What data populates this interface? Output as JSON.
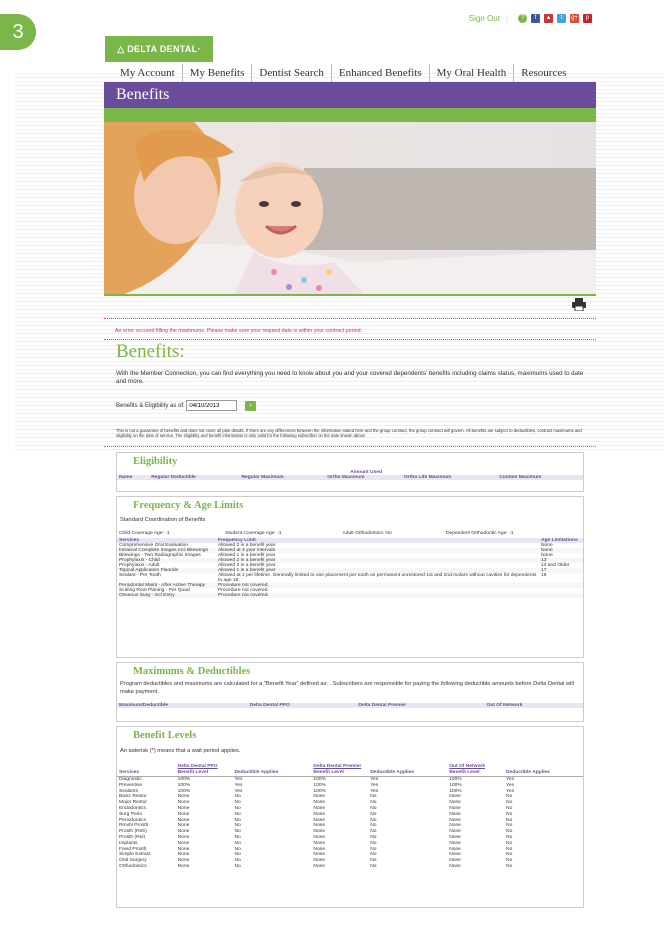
{
  "step": "3",
  "top": {
    "signout": "Sign Out",
    "help": "?",
    "social": [
      "f",
      "▲",
      "t",
      "g+",
      "p"
    ]
  },
  "logo": "△ DELTA DENTAL·",
  "nav": [
    "My Account",
    "My Benefits",
    "Dentist Search",
    "Enhanced Benefits",
    "My Oral Health",
    "Resources"
  ],
  "title_bar": "Benefits",
  "print_icon": "printer",
  "error": "An error occured filling the maximums. Please make sure your request date is within your contract period.",
  "heading": "Benefits:",
  "intro": "With the Member Connection, you can find everything you need to know about you and your covered dependents' benefits including claims status, maximums used to date and more.",
  "asof": {
    "label": "Benefits & Eligibility as of:",
    "value": "04/10/2013",
    "go": "›"
  },
  "disclaimer": "This is not a guarantee of benefits and does not cover all plan details. If there are any differences between the information stated here and the group contract, the group contract will govern. All benefits are subject to deductibles, contract maximums and eligibility on the date of service. The eligibility and benefit information is only valid for the following subscriber on the date shown above.",
  "eligibility": {
    "title": "Eligibility",
    "amount_used": "Amount Used",
    "cols": [
      "Name",
      "Regular Deductible",
      "Regular Maximum",
      "Ortho Maximum",
      "Ortho Life Maximum",
      "Custom Maximum"
    ]
  },
  "frequency": {
    "title": "Frequency & Age Limits",
    "cob": "Standard Coordination of Benefits",
    "ages": [
      "Child Coverage Age: -1",
      "Student Coverage Age: -1",
      "Adult Orthodontics: No",
      "Dependent Orthodontic Age: -1"
    ],
    "cols": [
      "Services",
      "Frequency Limit",
      "Age Limitations"
    ],
    "rows": [
      [
        "Comprehensive Oral Evaluation",
        "Allowed 2 in a benefit year",
        "None"
      ],
      [
        "Intraoral Complete Images Incl Bitewings",
        "Allowed at 3 year intervals",
        "None"
      ],
      [
        "Bitewings - Two Radiographic Images",
        "Allowed 1 in a benefit year",
        "None"
      ],
      [
        "Prophylaxis - Child",
        "Allowed 2 in a benefit year",
        "13"
      ],
      [
        "Prophylaxis - Adult",
        "Allowed 2 in a benefit year",
        "14 and Older"
      ],
      [
        "Topical Application Fluoride",
        "Allowed 1 in a benefit year",
        "17"
      ],
      [
        "Sealant - Per Tooth",
        "Allowed at 1 per lifetime. Generally limited to one placement per tooth on permanent unrestored 1st and 2nd molars without cavities for dependents to age 18.",
        "18"
      ],
      [
        "Periodontal Maint - After Active Therapy",
        "Procedure not covered.",
        ""
      ],
      [
        "Scaling Root Planing - Per Quad",
        "Procedure not covered.",
        ""
      ],
      [
        "Osseous Surg - Incl Entry",
        "Procedure not covered.",
        ""
      ]
    ]
  },
  "maximums": {
    "title": "Maximums & Deductibles",
    "text": "Program deductibles and maximums are calculated for a \"Benefit Year\" defined as: . Subscribers are responsible for paying the following deductible amounts before Delta Dental will make payment.",
    "cols": [
      "Maximum/Deductible",
      "Delta Dental PPO",
      "Delta Dental Premier",
      "Out Of Network"
    ]
  },
  "levels": {
    "title": "Benefit Levels",
    "note": "An asterisk (*) means that a wait period applies.",
    "groups": [
      "Delta Dental PPO",
      "Delta Dental Premier",
      "Out Of Network"
    ],
    "cols": [
      "Services",
      "Benefit Level",
      "Deductible Applies",
      "Benefit Level",
      "Deductible Applies",
      "Benefit Level",
      "Deductible Applies"
    ],
    "rows": [
      [
        "Diagnostic",
        "100%",
        "Yes",
        "100%",
        "Yes",
        "100%",
        "Yes"
      ],
      [
        "Preventive",
        "100%",
        "Yes",
        "100%",
        "Yes",
        "100%",
        "Yes"
      ],
      [
        "Sealants",
        "100%",
        "Yes",
        "100%",
        "Yes",
        "100%",
        "Yes"
      ],
      [
        "Basic Restor",
        "None",
        "No",
        "None",
        "No",
        "None",
        "No"
      ],
      [
        "Major Restor",
        "None",
        "No",
        "None",
        "No",
        "None",
        "No"
      ],
      [
        "Endodontics",
        "None",
        "No",
        "None",
        "No",
        "None",
        "No"
      ],
      [
        "Surg Perio",
        "None",
        "No",
        "None",
        "No",
        "None",
        "No"
      ],
      [
        "Periodontics",
        "None",
        "No",
        "None",
        "No",
        "None",
        "No"
      ],
      [
        "Rmvbl Prosth",
        "None",
        "No",
        "None",
        "No",
        "None",
        "No"
      ],
      [
        "Prosth (Reb)",
        "None",
        "No",
        "None",
        "No",
        "None",
        "No"
      ],
      [
        "Prosth (Rel)",
        "None",
        "No",
        "None",
        "No",
        "None",
        "No"
      ],
      [
        "Implants",
        "None",
        "No",
        "None",
        "No",
        "None",
        "No"
      ],
      [
        "Fixed Prosth",
        "None",
        "No",
        "None",
        "No",
        "None",
        "No"
      ],
      [
        "Simple Extract",
        "None",
        "No",
        "None",
        "No",
        "None",
        "No"
      ],
      [
        "Oral Surgery",
        "None",
        "No",
        "None",
        "No",
        "None",
        "No"
      ],
      [
        "Orthodontics",
        "None",
        "No",
        "None",
        "No",
        "None",
        "No"
      ]
    ]
  }
}
